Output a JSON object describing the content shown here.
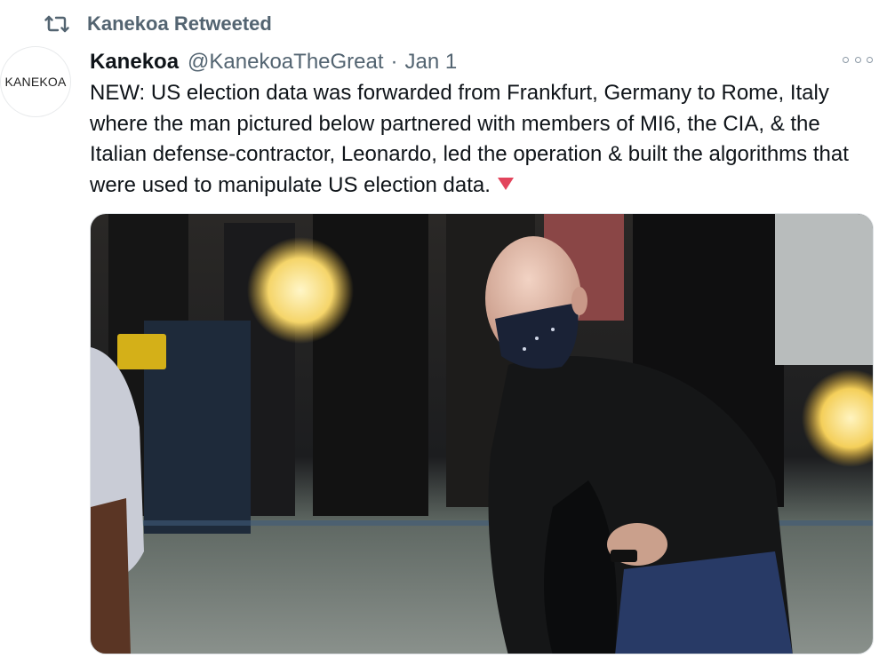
{
  "retweet": {
    "icon": "retweet-icon",
    "label": "Kanekoa Retweeted"
  },
  "tweet": {
    "avatar_text": "KANEKOA",
    "name": "Kanekoa",
    "handle": "@KanekoaTheGreat",
    "separator": "·",
    "date": "Jan 1",
    "text": "NEW: US election data was forwarded from Frankfurt, Germany to Rome, Italy where the man pictured below partnered with members of MI6, the CIA, & the Italian defense-contractor, Leonardo, led the operation & built the algorithms that were used to manipulate US election data.",
    "emoji": "red-triangle-down-icon",
    "more_icon": "more-options-icon"
  },
  "colors": {
    "secondary_text": "#536471",
    "primary_text": "#0f1419",
    "emoji_red": "#e2445c"
  }
}
